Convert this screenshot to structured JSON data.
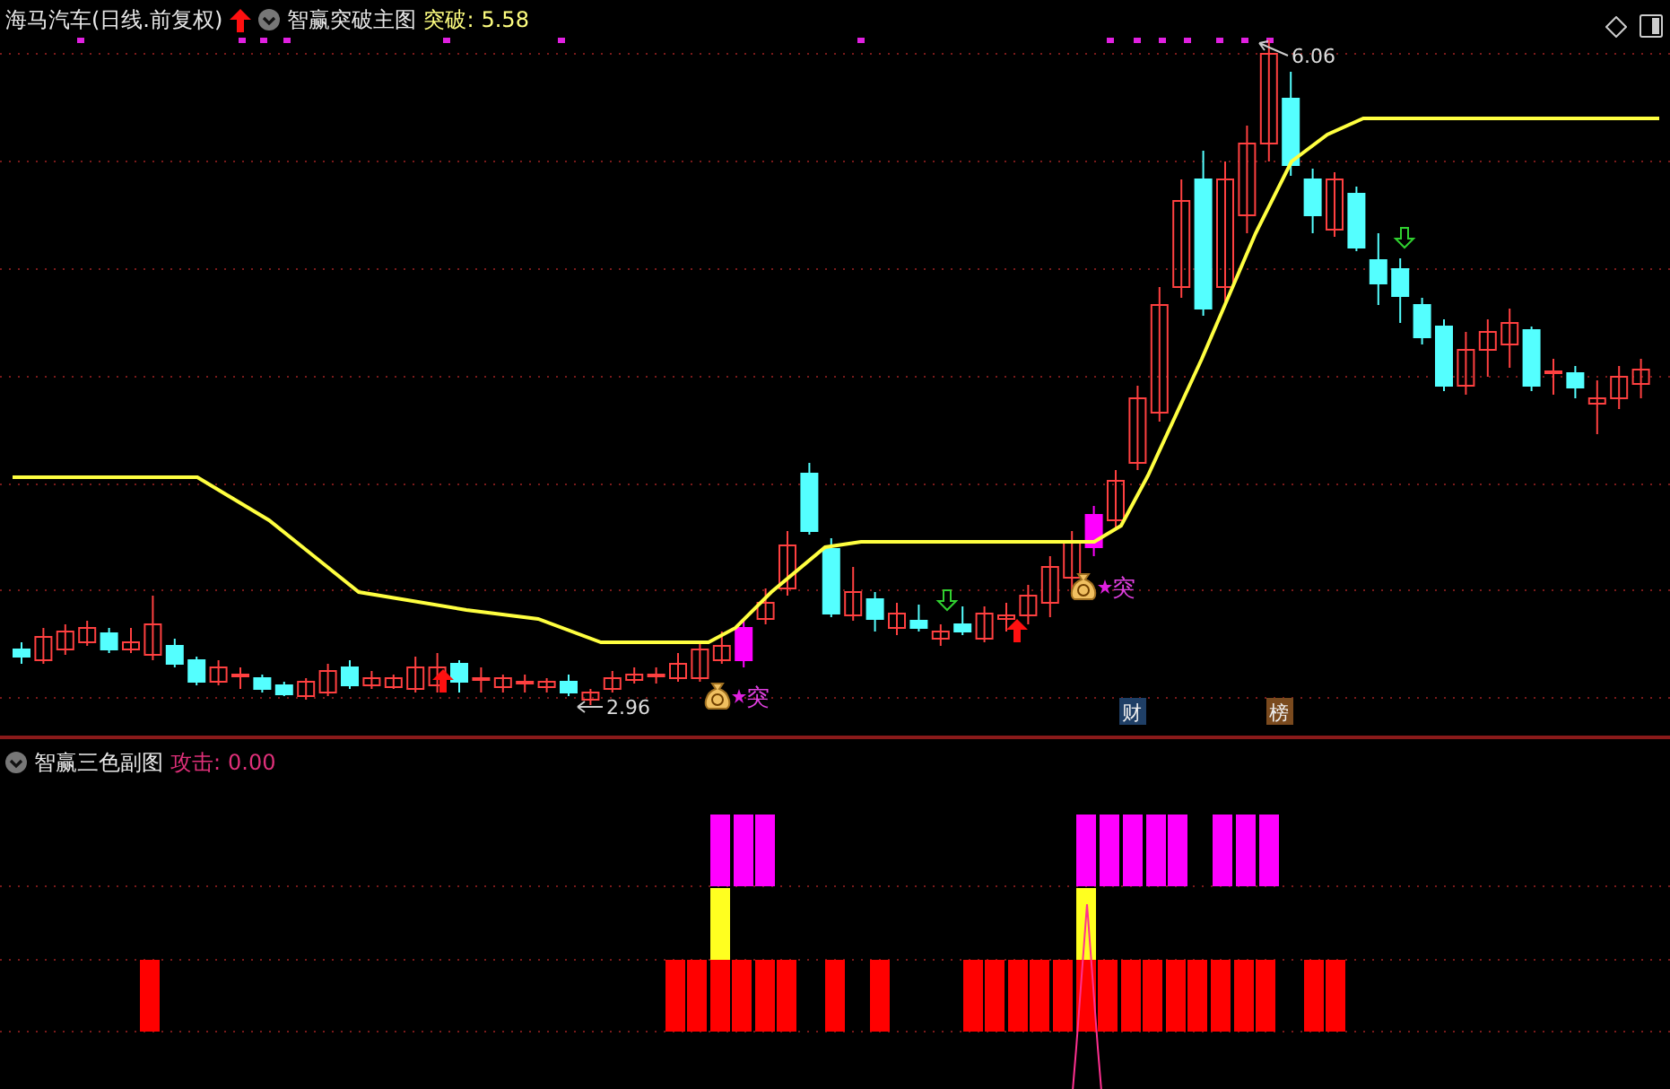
{
  "main_chart": {
    "stock": "海马汽车(日线.前复权)",
    "indicator": "智赢突破主图",
    "reading_label": "突破:",
    "reading_value": "5.58",
    "high_label": "6.06",
    "low_label": "2.96",
    "signals": [
      {
        "text": "突"
      },
      {
        "text": "突"
      }
    ],
    "badges": [
      {
        "text": "财",
        "color": "#1f3f66"
      },
      {
        "text": "榜",
        "color": "#7a4a1e"
      }
    ]
  },
  "sub_chart": {
    "indicator": "智赢三色副图",
    "reading_label": "攻击:",
    "reading_value": "0.00"
  }
}
